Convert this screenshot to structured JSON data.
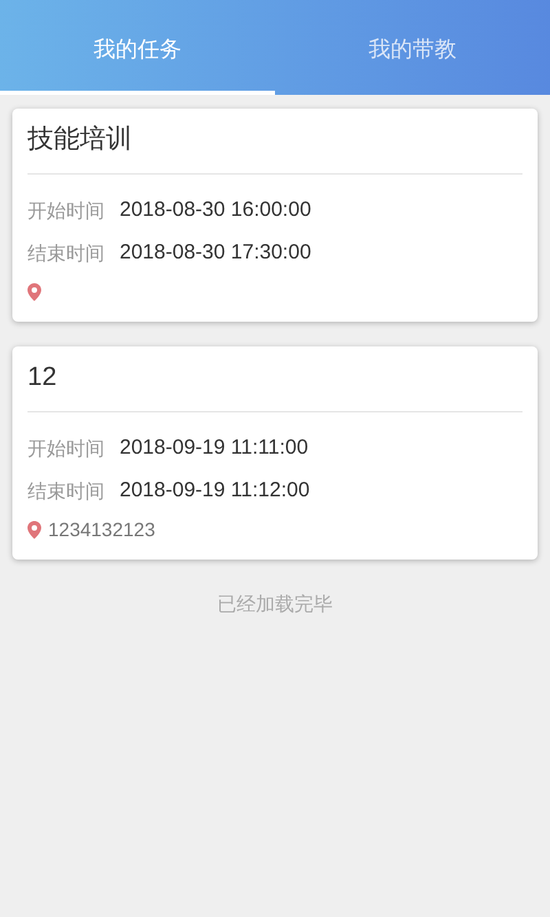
{
  "tabs": [
    {
      "label": "我的任务",
      "selected": true
    },
    {
      "label": "我的带教",
      "selected": false
    }
  ],
  "tasks": [
    {
      "title": "技能培训",
      "start_label": "开始时间",
      "start": "2018-08-30 16:00:00",
      "end_label": "结束时间",
      "end": "2018-08-30 17:30:00"
    },
    {
      "title": "12",
      "start_label": "开始时间",
      "start": "2018-09-19 11:11:00",
      "end_label": "结束时间",
      "end": "2018-09-19 11:12:00",
      "location": "1234132123"
    }
  ],
  "footer": "已经加载完毕"
}
